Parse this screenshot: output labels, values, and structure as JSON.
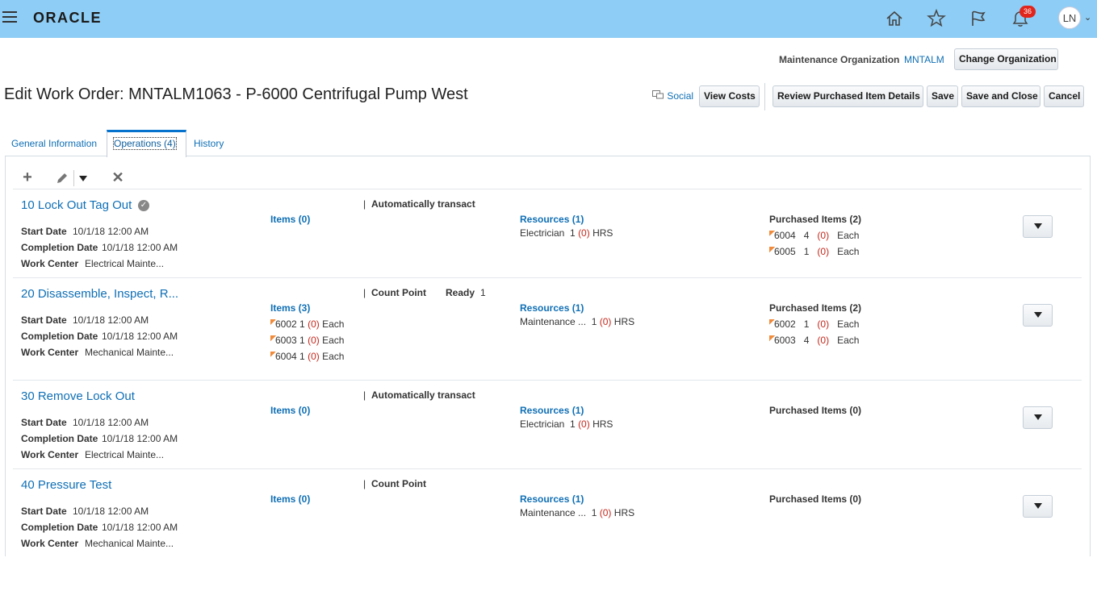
{
  "header": {
    "logo_text": "ORACLE",
    "notification_count": "36",
    "user_initials": "LN",
    "icons": [
      "home-icon",
      "favorites-star-icon",
      "watchlist-flag-icon",
      "notifications-bell-icon"
    ]
  },
  "org": {
    "label": "Maintenance Organization",
    "value": "MNTALM",
    "change_button": "Change Organization"
  },
  "page": {
    "title": "Edit Work Order: MNTALM1063 - P-6000 Centrifugal Pump West",
    "social_label": "Social",
    "buttons": {
      "view_costs": "View Costs",
      "review_purchased": "Review Purchased Item Details",
      "save": "Save",
      "save_close": "Save and Close",
      "cancel": "Cancel"
    }
  },
  "tabs": [
    {
      "label": "General Information"
    },
    {
      "label": "Operations (4)"
    },
    {
      "label": "History"
    }
  ],
  "toolbar": {
    "add": "+",
    "delete": "✕"
  },
  "labels": {
    "start_date": "Start Date",
    "completion_date": "Completion Date",
    "work_center": "Work Center"
  },
  "operations": [
    {
      "title": "10 Lock Out Tag Out",
      "start_date": "10/1/18 12:00 AM",
      "completion_date": "10/1/18 12:00 AM",
      "work_center": "Electrical Mainte...",
      "status_text": "Automatically transact",
      "items_label": "Items (0)",
      "resources_label": "Resources (1)",
      "resource": {
        "name": "Electrician",
        "qty": "1",
        "pending": "(0)",
        "uom": "HRS"
      },
      "purchased_label": "Purchased Items (2)",
      "purchased": [
        {
          "item": "6004",
          "qty": "4",
          "pending": "(0)",
          "uom": "Each"
        },
        {
          "item": "6005",
          "qty": "1",
          "pending": "(0)",
          "uom": "Each"
        }
      ]
    },
    {
      "title": "20 Disassemble, Inspect, R...",
      "start_date": "10/1/18 12:00 AM",
      "completion_date": "10/1/18 12:00 AM",
      "work_center": "Mechanical Mainte...",
      "status_text": "Count Point",
      "ready_label": "Ready",
      "ready_value": "1",
      "items_label": "Items (3)",
      "items": [
        {
          "item": "6002",
          "qty": "1",
          "pending": "(0)",
          "uom": "Each"
        },
        {
          "item": "6003",
          "qty": "1",
          "pending": "(0)",
          "uom": "Each"
        },
        {
          "item": "6004",
          "qty": "1",
          "pending": "(0)",
          "uom": "Each"
        }
      ],
      "resources_label": "Resources (1)",
      "resource": {
        "name": "Maintenance ...",
        "qty": "1",
        "pending": "(0)",
        "uom": "HRS"
      },
      "purchased_label": "Purchased Items (2)",
      "purchased": [
        {
          "item": "6002",
          "qty": "1",
          "pending": "(0)",
          "uom": "Each"
        },
        {
          "item": "6003",
          "qty": "4",
          "pending": "(0)",
          "uom": "Each"
        }
      ]
    },
    {
      "title": "30 Remove Lock Out",
      "start_date": "10/1/18 12:00 AM",
      "completion_date": "10/1/18 12:00 AM",
      "work_center": "Electrical Mainte...",
      "status_text": "Automatically transact",
      "items_label": "Items (0)",
      "resources_label": "Resources (1)",
      "resource": {
        "name": "Electrician",
        "qty": "1",
        "pending": "(0)",
        "uom": "HRS"
      },
      "purchased_label": "Purchased Items (0)"
    },
    {
      "title": "40 Pressure Test",
      "start_date": "10/1/18 12:00 AM",
      "completion_date": "10/1/18 12:00 AM",
      "work_center": "Mechanical Mainte...",
      "status_text": "Count Point",
      "items_label": "Items (0)",
      "resources_label": "Resources (1)",
      "resource": {
        "name": "Maintenance ...",
        "qty": "1",
        "pending": "(0)",
        "uom": "HRS"
      },
      "purchased_label": "Purchased Items (0)"
    }
  ]
}
